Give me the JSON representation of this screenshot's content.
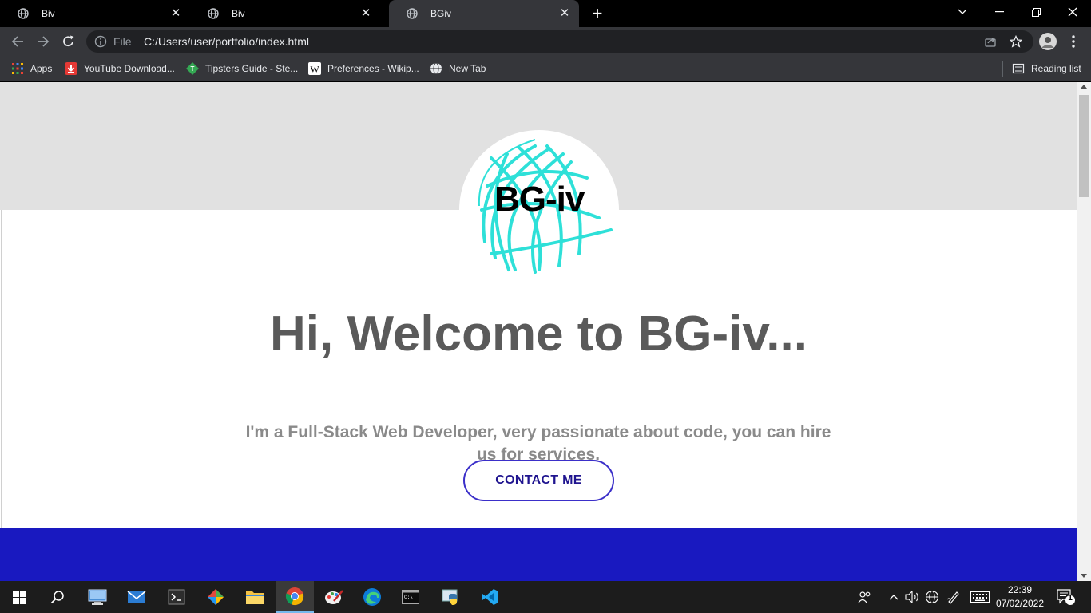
{
  "tabs": [
    {
      "title": "Biv",
      "active": false
    },
    {
      "title": "Biv",
      "active": false
    },
    {
      "title": "BGiv",
      "active": true
    }
  ],
  "address": {
    "scheme_label": "File",
    "url": "C:/Users/user/portfolio/index.html"
  },
  "bookmarks": [
    {
      "label": "Apps",
      "icon": "apps-grid-icon"
    },
    {
      "label": "YouTube Download...",
      "icon": "download-icon"
    },
    {
      "label": "Tipsters Guide - Ste...",
      "icon": "tipsters-icon"
    },
    {
      "label": "Preferences - Wikip...",
      "icon": "wikipedia-icon"
    },
    {
      "label": "New Tab",
      "icon": "globe-icon"
    }
  ],
  "reading_list": "Reading list",
  "page": {
    "logo_text": "BG-iv",
    "headline": "Hi, Welcome to BG-iv...",
    "tagline": "I'm a Full-Stack Web Developer, very passionate about code, you can hire us for services.",
    "contact_button": "CONTACT ME",
    "colors": {
      "accent": "#1919c0",
      "button_border": "#3b2fc9",
      "globe": "#2ee0d8",
      "headline": "#5a5a5a"
    }
  },
  "taskbar": {
    "time": "22:39",
    "date": "07/02/2022",
    "notification_count": "1",
    "apps": [
      "start",
      "search",
      "this-pc",
      "mail",
      "terminal",
      "git",
      "file-explorer",
      "chrome",
      "paint",
      "edge",
      "cmd",
      "python",
      "vscode"
    ]
  }
}
